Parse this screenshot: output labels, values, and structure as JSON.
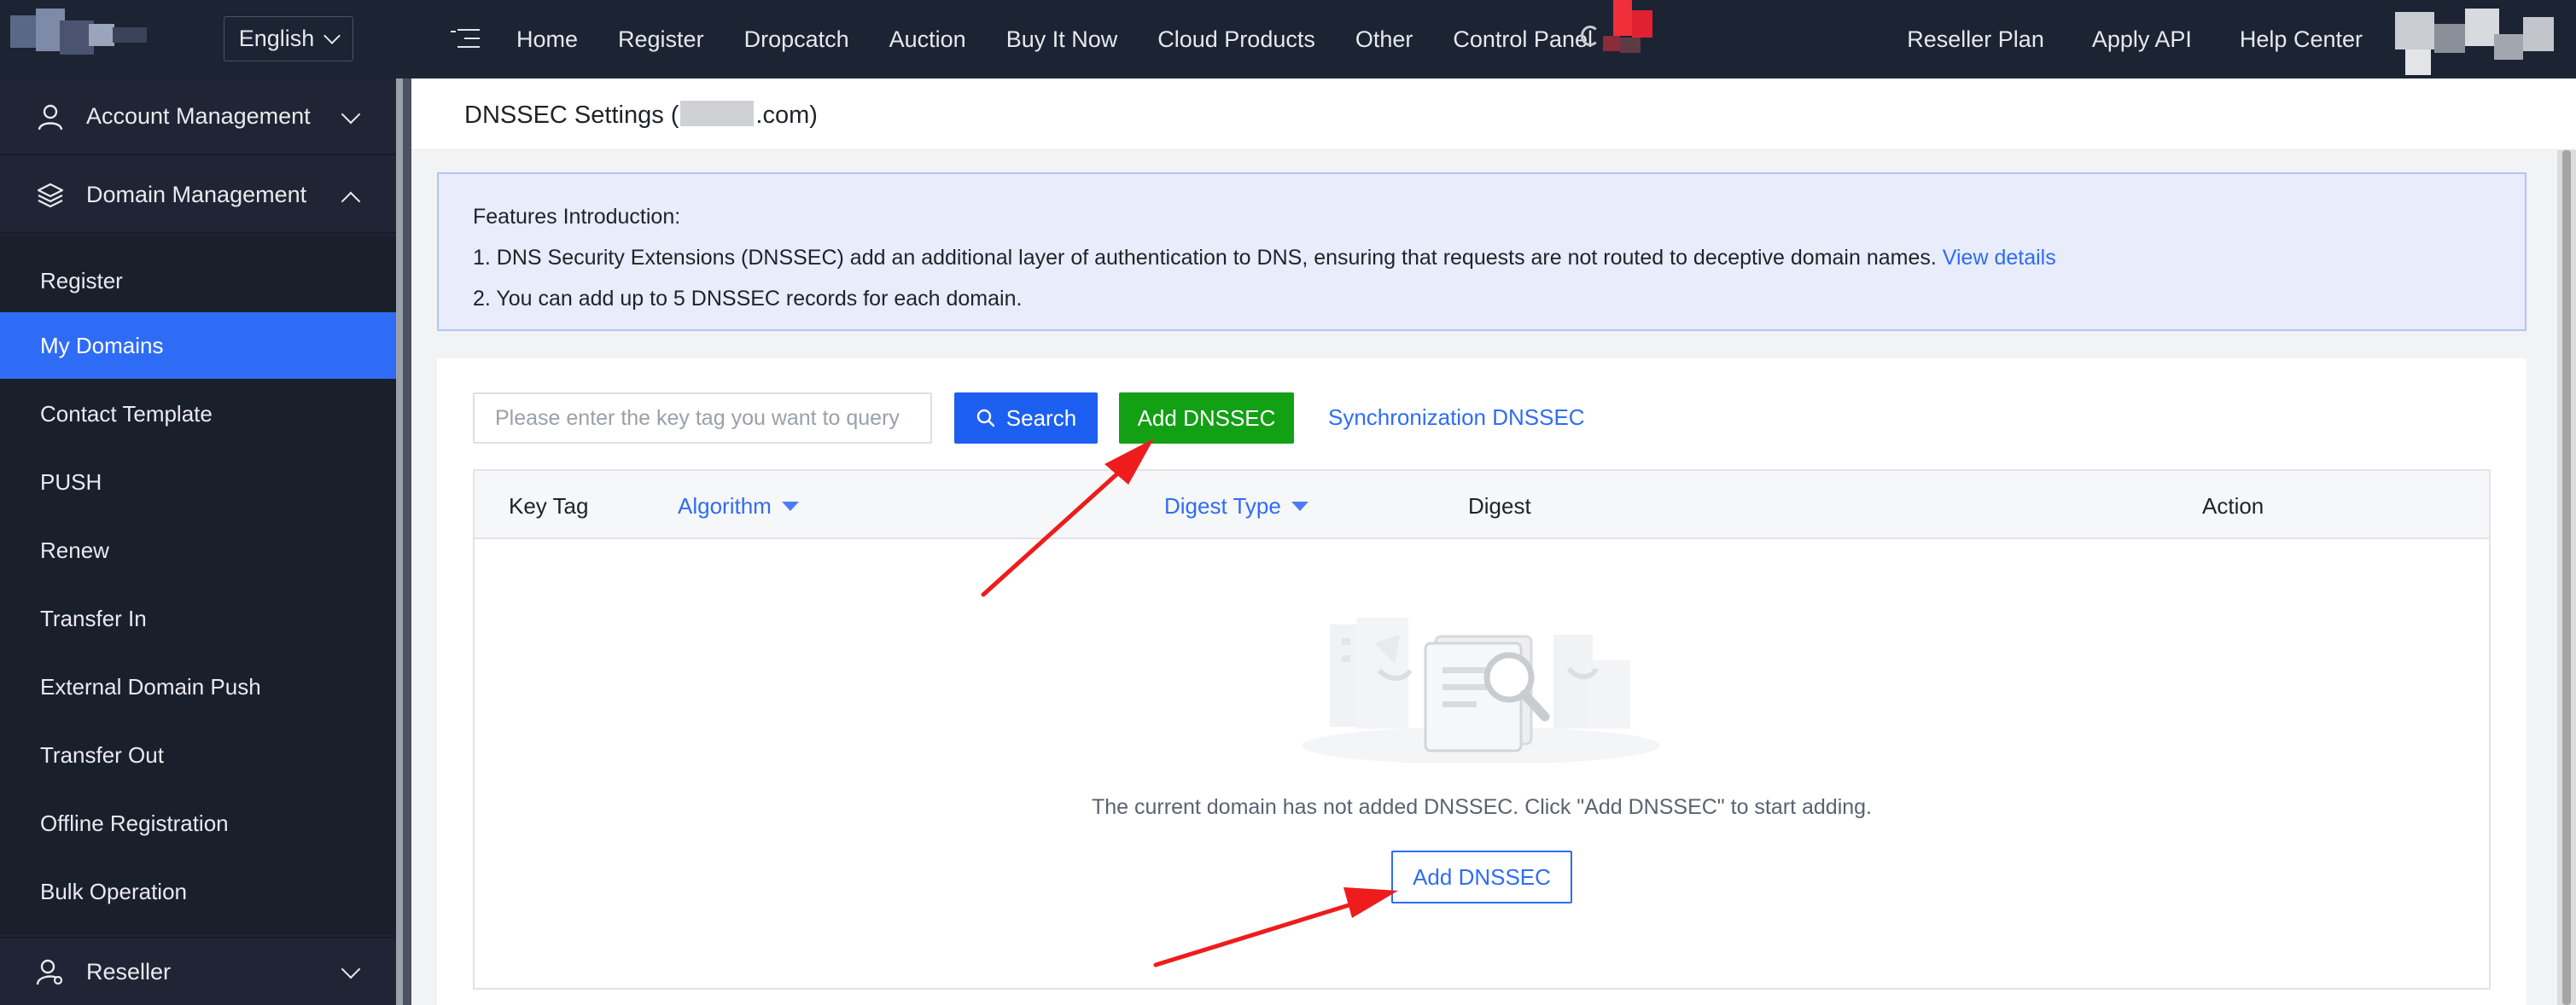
{
  "topbar": {
    "language": "English",
    "nav": [
      "Home",
      "Register",
      "Dropcatch",
      "Auction",
      "Buy It Now",
      "Cloud Products",
      "Other",
      "Control Panel"
    ],
    "right": [
      "Reseller Plan",
      "Apply API",
      "Help Center"
    ]
  },
  "sidebar": {
    "groups": {
      "account": "Account Management",
      "domain": "Domain Management",
      "reseller": "Reseller"
    },
    "items": [
      "Register",
      "My Domains",
      "Contact Template",
      "PUSH",
      "Renew",
      "Transfer In",
      "External Domain Push",
      "Transfer Out",
      "Offline Registration",
      "Bulk Operation"
    ],
    "active_item": "My Domains"
  },
  "page": {
    "title_prefix": "DNSSEC Settings (",
    "title_suffix": ".com)"
  },
  "info": {
    "heading": "Features Introduction:",
    "line1": "1. DNS Security Extensions (DNSSEC) add an additional layer of authentication to DNS, ensuring that requests are not routed to deceptive domain names.",
    "line1_link": "View details",
    "line2": "2. You can add up to 5 DNSSEC records for each domain."
  },
  "toolbar": {
    "search_placeholder": "Please enter the key tag you want to query",
    "search_label": "Search",
    "add_label": "Add DNSSEC",
    "sync_label": "Synchronization DNSSEC"
  },
  "table": {
    "columns": [
      "Key Tag",
      "Algorithm",
      "Digest Type",
      "Digest",
      "Action"
    ]
  },
  "empty": {
    "message": "The current domain has not added DNSSEC. Click \"Add DNSSEC\" to start adding.",
    "button_label": "Add DNSSEC"
  },
  "colors": {
    "topbar": "#1c2333",
    "sidebar": "#1f2535",
    "accent": "#2f6cf6",
    "green": "#12a014",
    "annotation_arrow": "#ee1c1c"
  }
}
